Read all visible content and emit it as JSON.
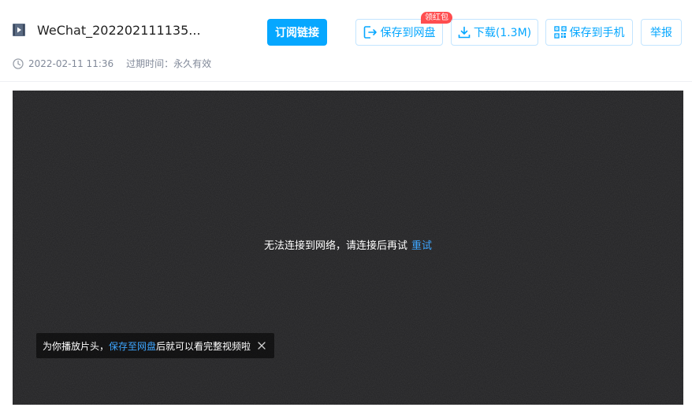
{
  "file": {
    "icon": "video-file-icon",
    "name": "WeChat_202202111135..."
  },
  "actions": {
    "subscribe_label": "订阅链接",
    "save_label": "保存到网盘",
    "save_badge": "领红包",
    "download_label": "下载(1.3M)",
    "phone_label": "保存到手机",
    "report_label": "举报"
  },
  "meta": {
    "date": "2022-02-11 11:36",
    "expire": "过期时间：永久有效"
  },
  "player": {
    "error_text": "无法连接到网络，请连接后再试",
    "retry_label": "重试",
    "tip_prefix": "为你播放片头，",
    "tip_link": "保存至网盘",
    "tip_suffix": "后就可以看完整视频啦"
  },
  "colors": {
    "accent": "#06a7ff",
    "badge": "#ff4d4f",
    "player_bg": "#1f1f21"
  }
}
